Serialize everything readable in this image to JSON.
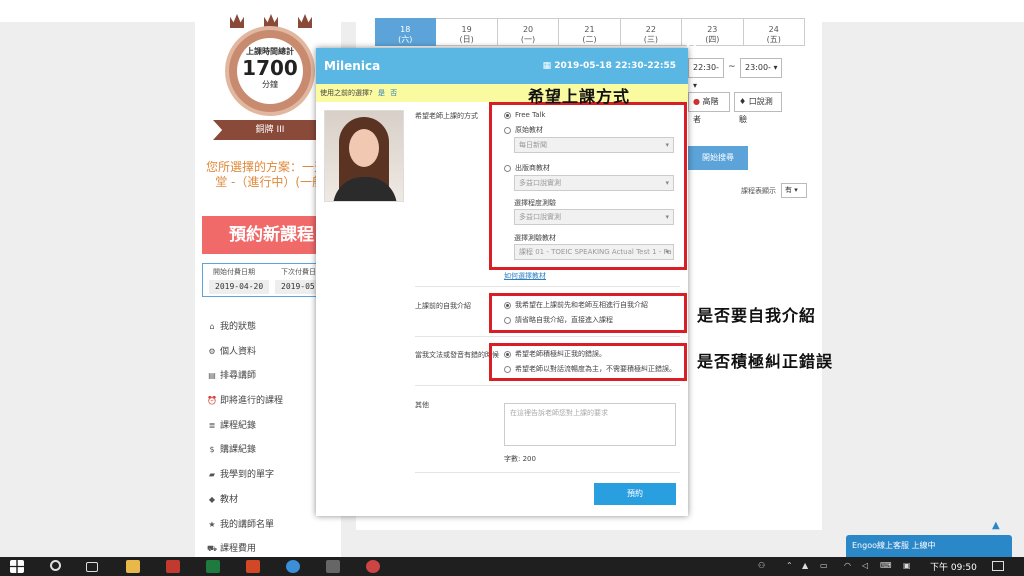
{
  "left": {
    "medal": {
      "label": "上課時間總計",
      "number": "1700",
      "unit": "分鐘"
    },
    "rank": "銅牌 III",
    "plan_text": "您所選擇的方案：一天一堂 -（進行中）(一般)",
    "book_button": "預約新課程",
    "dates": {
      "start_label": "開始付費日期",
      "start_value": "2019-04-20",
      "next_label": "下次付費日",
      "next_value": "2019-05-"
    },
    "menu": [
      {
        "icon": "home-icon",
        "glyph": "⌂",
        "label": "我的狀態"
      },
      {
        "icon": "gear-icon",
        "glyph": "⚙",
        "label": "個人資料"
      },
      {
        "icon": "book-icon",
        "glyph": "▤",
        "label": "排尋講師"
      },
      {
        "icon": "alarm-icon",
        "glyph": "⏰",
        "label": "即將進行的課程"
      },
      {
        "icon": "list-icon",
        "glyph": "≣",
        "label": "課程紀錄"
      },
      {
        "icon": "dollar-icon",
        "glyph": "$",
        "label": "購課紀錄"
      },
      {
        "icon": "folder-icon",
        "glyph": "▰",
        "label": "我學到的單字"
      },
      {
        "icon": "tag-icon",
        "glyph": "◆",
        "label": "教材"
      },
      {
        "icon": "star-icon",
        "glyph": "★",
        "label": "我的講師名單"
      },
      {
        "icon": "cart-icon",
        "glyph": "⛟",
        "label": "課程費用"
      }
    ]
  },
  "main_bg": {
    "calendar": [
      {
        "day": "18",
        "weekday": "(六)"
      },
      {
        "day": "19",
        "weekday": "(日)"
      },
      {
        "day": "20",
        "weekday": "(一)"
      },
      {
        "day": "21",
        "weekday": "(二)"
      },
      {
        "day": "22",
        "weekday": "(三)"
      },
      {
        "day": "23",
        "weekday": "(四)"
      },
      {
        "day": "24",
        "weekday": "(五)"
      }
    ],
    "time_from": "22:30-",
    "tilde": "~",
    "time_to": "23:00-",
    "native_btn": "高階者",
    "oral_btn": "口說測驗",
    "search_btn": "開始搜尋",
    "display_label": "課程表顯示",
    "display_value": "有"
  },
  "modal": {
    "teacher_name": "Milenica",
    "datetime": "2019-05-18 22:30-22:55",
    "close": "×",
    "prev_prompt": "使用之前的選擇?",
    "prev_yes": "是",
    "prev_no": "否",
    "method": {
      "label": "希望老師上課的方式",
      "free_talk": "Free Talk",
      "original": "原始教材",
      "original_select": "每日新聞",
      "publisher": "出版商教材",
      "publisher_select": "多益口說實測",
      "level_label": "選擇程度測驗",
      "level_select": "多益口說實測",
      "test_label": "選擇測驗教材",
      "test_select": "課程 01 - TOEIC SPEAKING Actual Test 1 - Pa",
      "how_link": "如何選擇教材"
    },
    "intro": {
      "label": "上課前的自我介紹",
      "opt1": "我希望在上課前先和老師互相進行自我介紹",
      "opt2": "請省略自我介紹，直接進入課程"
    },
    "correction": {
      "label": "當我文法或發音有錯的時候",
      "opt1": "希望老師積極糾正我的錯誤。",
      "opt2": "希望老師以對話流暢度為主，不需要積極糾正錯誤。"
    },
    "other": {
      "label": "其他",
      "placeholder": "在這裡告訴老師您對上課的要求",
      "char_count": "字數: 200"
    },
    "submit": "預約"
  },
  "annotations": {
    "method": "希望上課方式",
    "intro": "是否要自我介紹",
    "correction": "是否積極糾正錯誤"
  },
  "chat": {
    "label": "Engoo線上客服 上線中"
  },
  "taskbar": {
    "time": "下午 09:50"
  },
  "colors": {
    "header_blue": "#5ab7e3",
    "highlight_red": "#d81f26",
    "book_red": "#f06a6a",
    "plan_orange": "#e08a3c",
    "prev_bar_yellow": "#fafaa0"
  }
}
